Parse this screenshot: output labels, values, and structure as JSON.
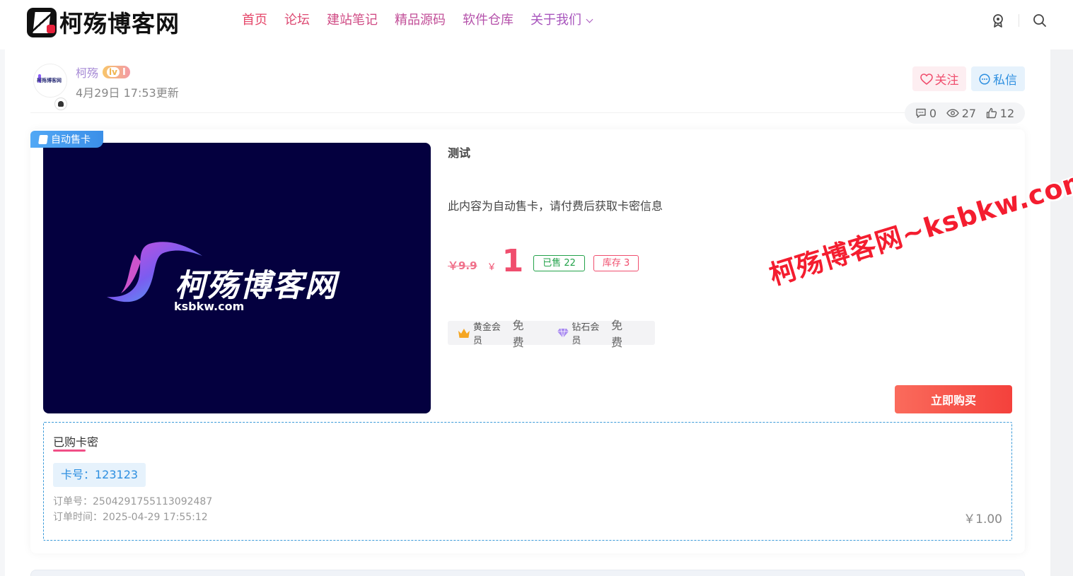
{
  "header": {
    "logo_text": "柯殇博客网",
    "nav": [
      {
        "label": "首页",
        "color": "#e5476a"
      },
      {
        "label": "论坛",
        "color": "#dd4a73"
      },
      {
        "label": "建站笔记",
        "color": "#d04c85"
      },
      {
        "label": "精品源码",
        "color": "#c24f98"
      },
      {
        "label": "软件仓库",
        "color": "#b552ab"
      },
      {
        "label": "关于我们",
        "color": "#a855bd",
        "has_dropdown": true
      }
    ],
    "icons": [
      "medal-icon",
      "search-icon"
    ]
  },
  "author": {
    "name": "柯殇",
    "level_badge": "I",
    "level_prefix": "lv",
    "updated": "4月29日 17:53更新",
    "follow_label": "关注",
    "message_label": "私信"
  },
  "stats": {
    "comments": "0",
    "views": "27",
    "likes": "12"
  },
  "product": {
    "tag": "自动售卡",
    "cover_title": "柯殇博客网",
    "cover_subtitle": "ksbkw.com",
    "title": "测试",
    "description": "此内容为自动售卡，请付费后获取卡密信息",
    "old_price": "￥9.9",
    "currency": "￥",
    "price": "1",
    "sold": "已售 22",
    "stock": "库存 3",
    "vip": [
      {
        "name": "黄金会员",
        "value": "免费",
        "icon": "crown-icon"
      },
      {
        "name": "钻石会员",
        "value": "免费",
        "icon": "diamond-icon"
      }
    ],
    "buy_label": "立即购买"
  },
  "purchased": {
    "title": "已购卡密",
    "card": "卡号：123123",
    "order_no": "订单号：250429175511309248​7",
    "order_time": "订单时间：2025-04-29 17:55:12",
    "amount": "￥1.00"
  },
  "watermark": "柯殇博客网~ksbkw.com",
  "colors": {
    "accent": "#f04e6e",
    "blue": "#2d8fe0",
    "cover_bg": "#04003f"
  }
}
